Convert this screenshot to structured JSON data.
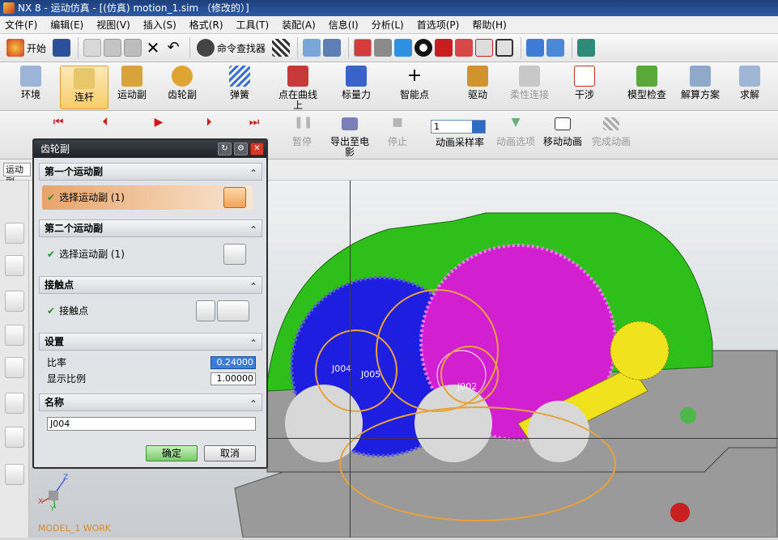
{
  "window": {
    "title": "NX 8 - 运动仿真 - [(仿真) motion_1.sim （修改的）]"
  },
  "menu": [
    "文件(F)",
    "编辑(E)",
    "视图(V)",
    "插入(S)",
    "格式(R)",
    "工具(T)",
    "装配(A)",
    "信息(I)",
    "分析(L)",
    "首选项(P)",
    "帮助(H)"
  ],
  "toolbar": {
    "start_label": "开始",
    "command_finder": "命令查找器"
  },
  "ribbon": [
    {
      "label": "环境",
      "state": "normal"
    },
    {
      "label": "连杆",
      "state": "active"
    },
    {
      "label": "运动副",
      "state": "normal"
    },
    {
      "label": "齿轮副",
      "state": "normal"
    },
    {
      "label": "弹簧",
      "state": "normal"
    },
    {
      "label": "点在曲线上",
      "state": "normal"
    },
    {
      "label": "标量力",
      "state": "normal"
    },
    {
      "label": "智能点",
      "state": "normal"
    },
    {
      "label": "驱动",
      "state": "normal"
    },
    {
      "label": "柔性连接",
      "state": "disabled"
    },
    {
      "label": "干涉",
      "state": "normal"
    },
    {
      "label": "模型检查",
      "state": "normal"
    },
    {
      "label": "解算方案",
      "state": "normal"
    },
    {
      "label": "求解",
      "state": "normal"
    }
  ],
  "animation": {
    "pause_label": "暂停",
    "export_label": "导出至电影",
    "stop_label": "停止",
    "rate_value": "1",
    "rate_label": "动画采样率",
    "options_label": "动画选项",
    "move_label": "移动动画",
    "finish_label": "完成动画"
  },
  "filter": {
    "value": "运动副"
  },
  "dialog": {
    "title": "齿轮副",
    "section1": "第一个运动副",
    "select1": "选择运动副 (1)",
    "section2": "第二个运动副",
    "select2": "选择运动副 (1)",
    "section3": "接触点",
    "contact": "接触点",
    "section4": "设置",
    "ratio_label": "比率",
    "ratio_value": "0.24000",
    "scale_label": "显示比例",
    "scale_value": "1.00000",
    "section5": "名称",
    "name_value": "J004",
    "ok": "确定",
    "cancel": "取消"
  },
  "scene": {
    "joint_labels": [
      "J004",
      "J005",
      "J002"
    ],
    "colors": {
      "housing": "#2fbf1a",
      "gear_blue": "#1e1ee0",
      "gear_magenta": "#d21fd0",
      "shaft": "#f0e21c",
      "base": "#9a9a9a",
      "joint": "#e8a23a"
    }
  },
  "triad": {
    "x": "X",
    "y": "Y",
    "z": "Z"
  },
  "model_label": "MODEL_1 WORK"
}
